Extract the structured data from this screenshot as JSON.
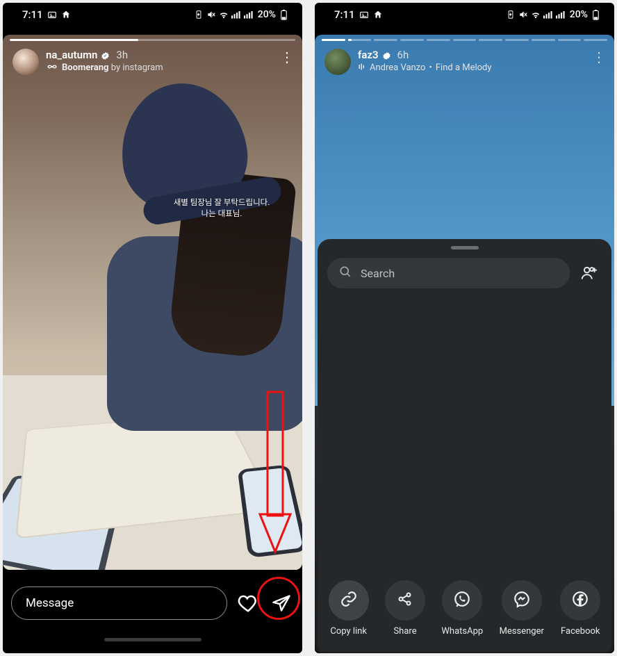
{
  "status": {
    "time": "7:11",
    "battery_pct": "20%"
  },
  "left": {
    "username": "na_autumn",
    "time": "3h",
    "sub_prefix": "Boomerang",
    "sub_suffix": "by instagram",
    "caption_line1": "새별 팀장님 잘 부탁드립니다.",
    "caption_line2": "나는 대표님.",
    "message_placeholder": "Message"
  },
  "right": {
    "username": "faz3",
    "time": "6h",
    "music_artist": "Andrea Vanzo",
    "music_title": "Find a Melody",
    "search_placeholder": "Search",
    "share": {
      "copy_link": "Copy link",
      "share": "Share",
      "whatsapp": "WhatsApp",
      "messenger": "Messenger",
      "facebook": "Facebook"
    }
  }
}
